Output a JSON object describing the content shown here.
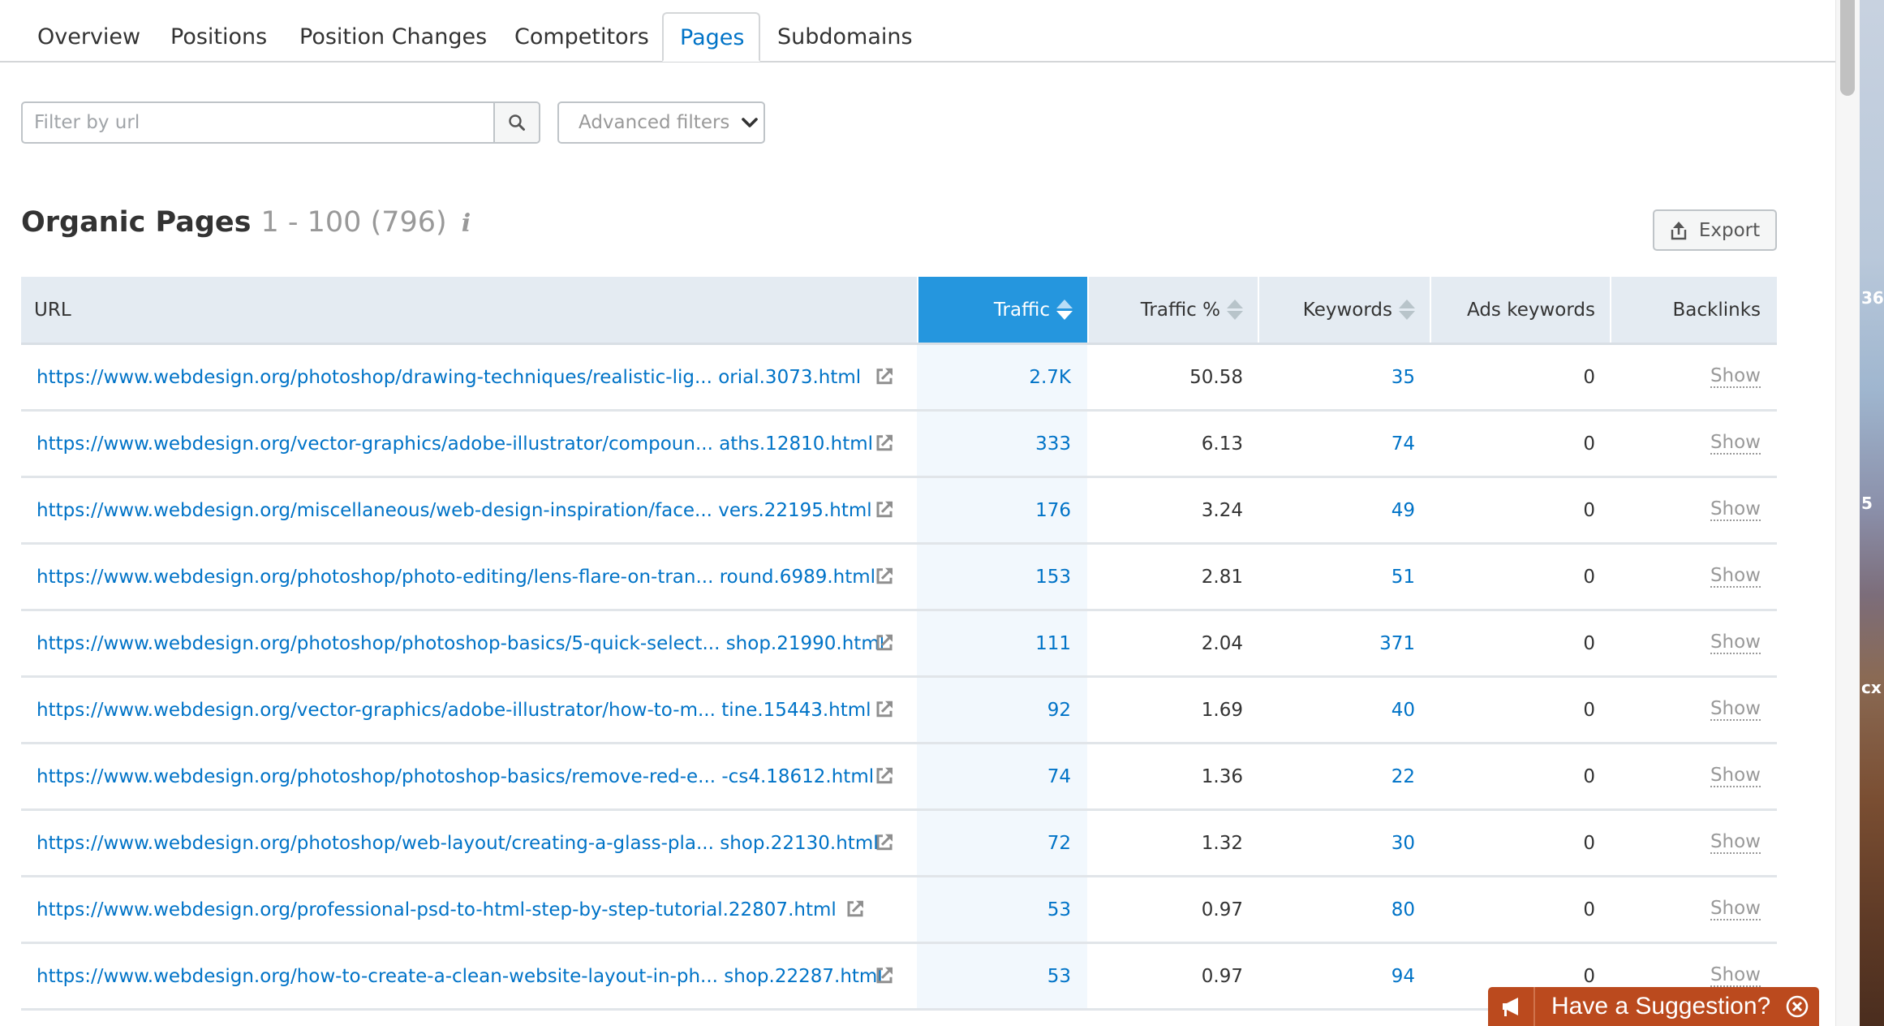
{
  "tabs": [
    {
      "label": "Overview",
      "active": false
    },
    {
      "label": "Positions",
      "active": false
    },
    {
      "label": "Position Changes",
      "active": false
    },
    {
      "label": "Competitors",
      "active": false
    },
    {
      "label": "Pages",
      "active": true
    },
    {
      "label": "Subdomains",
      "active": false
    }
  ],
  "filter": {
    "placeholder": "Filter by url",
    "value": "",
    "search_icon": "search-icon",
    "advanced_label": "Advanced filters",
    "advanced_icon": "chevron-down-icon"
  },
  "section": {
    "title": "Organic Pages",
    "range": "1 - 100 (796)",
    "info_icon": "i",
    "export_label": "Export"
  },
  "table": {
    "columns": [
      {
        "key": "url",
        "label": "URL",
        "sortable": false
      },
      {
        "key": "traffic",
        "label": "Traffic",
        "sortable": true,
        "sorted": true
      },
      {
        "key": "traffic_pct",
        "label": "Traffic %",
        "sortable": true
      },
      {
        "key": "keywords",
        "label": "Keywords",
        "sortable": true
      },
      {
        "key": "ads_keywords",
        "label": "Ads keywords",
        "sortable": false
      },
      {
        "key": "backlinks",
        "label": "Backlinks",
        "sortable": false
      }
    ],
    "rows": [
      {
        "url": "https://www.webdesign.org/photoshop/drawing-techniques/realistic-lig... orial.3073.html",
        "traffic": "2.7K",
        "traffic_pct": "50.58",
        "keywords": "35",
        "ads_keywords": "0",
        "backlinks": "Show"
      },
      {
        "url": "https://www.webdesign.org/vector-graphics/adobe-illustrator/compoun... aths.12810.html",
        "traffic": "333",
        "traffic_pct": "6.13",
        "keywords": "74",
        "ads_keywords": "0",
        "backlinks": "Show"
      },
      {
        "url": "https://www.webdesign.org/miscellaneous/web-design-inspiration/face... vers.22195.html",
        "traffic": "176",
        "traffic_pct": "3.24",
        "keywords": "49",
        "ads_keywords": "0",
        "backlinks": "Show"
      },
      {
        "url": "https://www.webdesign.org/photoshop/photo-editing/lens-flare-on-tran... round.6989.html",
        "traffic": "153",
        "traffic_pct": "2.81",
        "keywords": "51",
        "ads_keywords": "0",
        "backlinks": "Show"
      },
      {
        "url": "https://www.webdesign.org/photoshop/photoshop-basics/5-quick-select... shop.21990.html",
        "traffic": "111",
        "traffic_pct": "2.04",
        "keywords": "371",
        "ads_keywords": "0",
        "backlinks": "Show"
      },
      {
        "url": "https://www.webdesign.org/vector-graphics/adobe-illustrator/how-to-m... tine.15443.html",
        "traffic": "92",
        "traffic_pct": "1.69",
        "keywords": "40",
        "ads_keywords": "0",
        "backlinks": "Show"
      },
      {
        "url": "https://www.webdesign.org/photoshop/photoshop-basics/remove-red-e... -cs4.18612.html",
        "traffic": "74",
        "traffic_pct": "1.36",
        "keywords": "22",
        "ads_keywords": "0",
        "backlinks": "Show"
      },
      {
        "url": "https://www.webdesign.org/photoshop/web-layout/creating-a-glass-pla... shop.22130.html",
        "traffic": "72",
        "traffic_pct": "1.32",
        "keywords": "30",
        "ads_keywords": "0",
        "backlinks": "Show"
      },
      {
        "url": "https://www.webdesign.org/professional-psd-to-html-step-by-step-tutorial.22807.html",
        "traffic": "53",
        "traffic_pct": "0.97",
        "keywords": "80",
        "ads_keywords": "0",
        "backlinks": "Show"
      },
      {
        "url": "https://www.webdesign.org/how-to-create-a-clean-website-layout-in-ph... shop.22287.html",
        "traffic": "53",
        "traffic_pct": "0.97",
        "keywords": "94",
        "ads_keywords": "0",
        "backlinks": "Show"
      }
    ]
  },
  "suggestion": {
    "label": "Have a Suggestion?",
    "icon": "megaphone-icon",
    "close_icon": "close-circle-icon"
  },
  "desktop_labels": [
    "36",
    "5",
    "cx"
  ],
  "colors": {
    "accent": "#0073c7",
    "sorted_header": "#2596de",
    "header_bg": "#e4ebf2",
    "suggestion_bg": "#bb4a1e"
  }
}
